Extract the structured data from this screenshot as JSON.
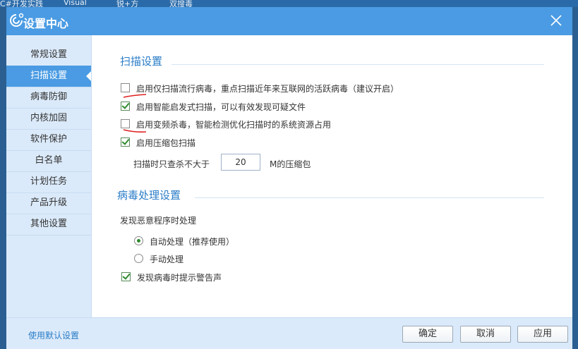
{
  "desktop": {
    "labels": [
      "C#开发实践",
      "Visual",
      "锐+方",
      "双搜毒"
    ]
  },
  "window": {
    "title": "设置中心"
  },
  "sidebar": {
    "items": [
      {
        "label": "常规设置"
      },
      {
        "label": "扫描设置"
      },
      {
        "label": "病毒防御"
      },
      {
        "label": "内核加固"
      },
      {
        "label": "软件保护"
      },
      {
        "label": "白名单"
      },
      {
        "label": "计划任务"
      },
      {
        "label": "产品升级"
      },
      {
        "label": "其他设置"
      }
    ],
    "active_index": 1
  },
  "scan": {
    "title": "扫描设置",
    "options": [
      {
        "label": "启用仅扫描流行病毒，重点扫描近年来互联网的活跃病毒（建议开启）",
        "checked": false
      },
      {
        "label": "启用智能启发式扫描，可以有效发现可疑文件",
        "checked": true
      },
      {
        "label": "启用变频杀毒，智能检测优化扫描时的系统资源占用",
        "checked": false
      },
      {
        "label": "启用压缩包扫描",
        "checked": true
      }
    ],
    "archive_limit_prefix": "扫描时只查杀不大于",
    "archive_limit_value": "20",
    "archive_limit_suffix": "M的压缩包"
  },
  "virus": {
    "title": "病毒处理设置",
    "subtitle": "发现恶意程序时处理",
    "radios": [
      {
        "label": "自动处理（推荐使用）",
        "selected": true
      },
      {
        "label": "手动处理",
        "selected": false
      }
    ],
    "alert": {
      "label": "发现病毒时提示警告声",
      "checked": true
    }
  },
  "footer": {
    "default_link": "使用默认设置",
    "ok": "确定",
    "cancel": "取消",
    "apply": "应用"
  },
  "colors": {
    "accent": "#4a9be3",
    "sidebar_bg": "#dbeafa",
    "check": "#2e8a2e",
    "annotation": "#e02020"
  }
}
